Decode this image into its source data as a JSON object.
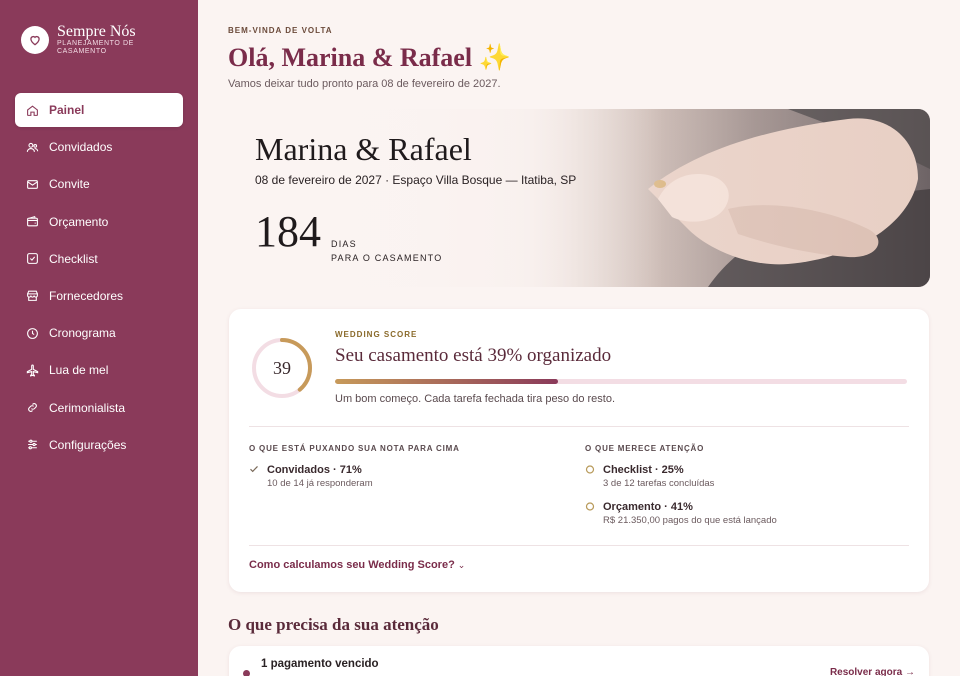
{
  "brand": {
    "name": "Sempre Nós",
    "subtitle": "PLANEJAMENTO DE CASAMENTO",
    "logo_icon": "heart-icon"
  },
  "nav": [
    {
      "label": "Painel",
      "icon": "home-icon",
      "active": true
    },
    {
      "label": "Convidados",
      "icon": "users-icon"
    },
    {
      "label": "Convite",
      "icon": "mail-icon"
    },
    {
      "label": "Orçamento",
      "icon": "wallet-icon"
    },
    {
      "label": "Checklist",
      "icon": "checkbox-icon"
    },
    {
      "label": "Fornecedores",
      "icon": "store-icon"
    },
    {
      "label": "Cronograma",
      "icon": "clock-icon"
    },
    {
      "label": "Lua de mel",
      "icon": "plane-icon"
    },
    {
      "label": "Cerimonialista",
      "icon": "link-icon"
    },
    {
      "label": "Configurações",
      "icon": "sliders-icon"
    }
  ],
  "header": {
    "eyebrow": "BEM-VINDA DE VOLTA",
    "greeting": "Olá, Marina & Rafael ✨",
    "subtitle": "Vamos deixar tudo pronto para 08 de fevereiro de 2027."
  },
  "hero": {
    "couple": "Marina & Rafael",
    "details": "08 de fevereiro de 2027 · Espaço Villa Bosque — Itatiba, SP",
    "days": "184",
    "days_label_1": "DIAS",
    "days_label_2": "PARA O CASAMENTO"
  },
  "score": {
    "value": "39",
    "percent": 39,
    "eyebrow": "WEDDING SCORE",
    "title": "Seu casamento está 39% organizado",
    "subtitle": "Um bom começo. Cada tarefa fechada tira peso do resto.",
    "up_heading": "O QUE ESTÁ PUXANDO SUA NOTA PARA CIMA",
    "up_items": [
      {
        "title": "Convidados · 71%",
        "sub": "10 de 14 já responderam"
      }
    ],
    "attention_heading": "O QUE MERECE ATENÇÃO",
    "attention_items": [
      {
        "title": "Checklist · 25%",
        "sub": "3 de 12 tarefas concluídas"
      },
      {
        "title": "Orçamento · 41%",
        "sub": "R$ 21.350,00 pagos do que está lançado"
      }
    ],
    "link": "Como calculamos seu Wedding Score?",
    "accent_colors": {
      "gold": "#c79a5a",
      "wine": "#8a3a5a"
    }
  },
  "attention": {
    "title": "O que precisa da sua atenção",
    "items": [
      {
        "title": "1 pagamento vencido",
        "action": "Resolver agora →"
      }
    ]
  }
}
